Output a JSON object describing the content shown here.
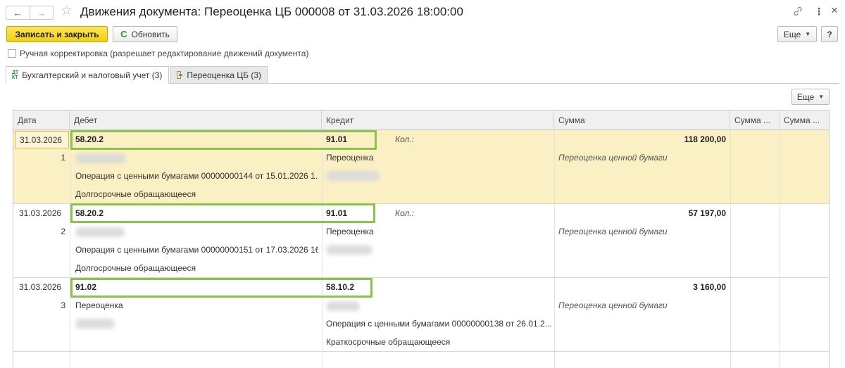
{
  "window": {
    "title": "Движения документа: Переоценка ЦБ 000008 от 31.03.2026 18:00:00"
  },
  "toolbar": {
    "save_close_label": "Записать и закрыть",
    "refresh_label": "Обновить",
    "more_label": "Еще",
    "help_label": "?"
  },
  "manual_correction": {
    "label": "Ручная корректировка (разрешает редактирование движений документа)",
    "checked": false
  },
  "tabs": [
    {
      "label": "Бухгалтерский и налоговый учет (3)",
      "active": true
    },
    {
      "label": "Переоценка ЦБ (3)",
      "active": false
    }
  ],
  "table_toolbar": {
    "more_label": "Еще"
  },
  "table": {
    "columns": [
      "Дата",
      "Дебет",
      "Кредит",
      "Сумма",
      "Сумма ...",
      "Сумма ..."
    ],
    "rows": [
      {
        "date": "31.03.2026",
        "number": "1",
        "debit_account": "58.20.2",
        "debit_line3": "Операция с ценными бумагами 00000000144 от 15.01.2026 1...",
        "debit_line4": "Долгосрочные обращающееся",
        "credit_account": "91.01",
        "credit_qty_label": "Кол.:",
        "credit_line2": "Переоценка",
        "credit_line3": "",
        "credit_line4": "",
        "amount": "118 200,00",
        "content": "Переоценка ценной бумаги",
        "selected": true
      },
      {
        "date": "31.03.2026",
        "number": "2",
        "debit_account": "58.20.2",
        "debit_line3": "Операция с ценными бумагами 00000000151 от 17.03.2026 16...",
        "debit_line4": "Долгосрочные обращающееся",
        "credit_account": "91.01",
        "credit_qty_label": "Кол.:",
        "credit_line2": "Переоценка",
        "credit_line3": "",
        "credit_line4": "",
        "amount": "57 197,00",
        "content": "Переоценка ценной бумаги",
        "selected": false
      },
      {
        "date": "31.03.2026",
        "number": "3",
        "debit_account": "91.02",
        "debit_line2": "Переоценка",
        "credit_account": "58.10.2",
        "credit_line3": "Операция с ценными бумагами 00000000138 от 26.01.2...",
        "credit_line4": "Краткосрочные обращающееся",
        "amount": "3 160,00",
        "content": "Переоценка ценной бумаги",
        "selected": false
      }
    ]
  },
  "highlight_color": "#8bc34a",
  "selection_color": "#fbefc4",
  "accent_button_color": "#f2cf10"
}
